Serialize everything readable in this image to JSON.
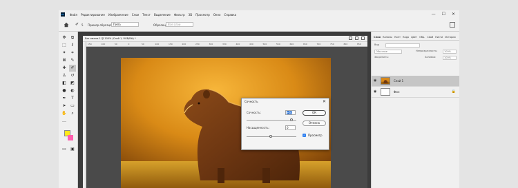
{
  "app": {
    "logo": "Ps",
    "menus": [
      "Файл",
      "Редактирование",
      "Изображение",
      "Слои",
      "Текст",
      "Выделение",
      "Фильтр",
      "3D",
      "Просмотр",
      "Окно",
      "Справка"
    ],
    "window_controls": [
      "—",
      "☐",
      "✕"
    ]
  },
  "options_bar": {
    "brush_size": "5",
    "sample_label": "Пример образца:",
    "sample_value": "Пипа",
    "normal_label": "Образец:",
    "normal_value": "Все слои"
  },
  "toolbar": {
    "tools": [
      {
        "name": "move-tool-icon",
        "glyph": "✥"
      },
      {
        "name": "artboard-tool-icon",
        "glyph": "⧉"
      },
      {
        "name": "marquee-tool-icon",
        "glyph": "⬚"
      },
      {
        "name": "lasso-tool-icon",
        "glyph": "ℓ"
      },
      {
        "name": "magic-wand-tool-icon",
        "glyph": "✦"
      },
      {
        "name": "crop-tool-icon",
        "glyph": "⌗"
      },
      {
        "name": "frame-tool-icon",
        "glyph": "⊠"
      },
      {
        "name": "eyedropper-tool-icon",
        "glyph": "✎"
      },
      {
        "name": "healing-brush-tool-icon",
        "glyph": "✚"
      },
      {
        "name": "brush-tool-icon",
        "glyph": "✐"
      },
      {
        "name": "stamp-tool-icon",
        "glyph": "♙"
      },
      {
        "name": "history-brush-tool-icon",
        "glyph": "↺"
      },
      {
        "name": "eraser-tool-icon",
        "glyph": "◧"
      },
      {
        "name": "gradient-tool-icon",
        "glyph": "◩"
      },
      {
        "name": "blur-tool-icon",
        "glyph": "●"
      },
      {
        "name": "dodge-tool-icon",
        "glyph": "◐"
      },
      {
        "name": "pen-tool-icon",
        "glyph": "✒"
      },
      {
        "name": "text-tool-icon",
        "glyph": "T"
      },
      {
        "name": "path-selection-tool-icon",
        "glyph": "➤"
      },
      {
        "name": "rectangle-tool-icon",
        "glyph": "▭"
      },
      {
        "name": "hand-tool-icon",
        "glyph": "✋"
      },
      {
        "name": "zoom-tool-icon",
        "glyph": "⌕"
      },
      {
        "name": "more-tools-icon",
        "glyph": "…"
      }
    ],
    "fg_color": "#ffe81a",
    "bg_color": "#ff5fae",
    "bottom_icons": [
      "▭",
      "▣"
    ]
  },
  "document": {
    "tab_title": "Без имени-1 @ 100% (Слой 1, RGB/8#) *",
    "ruler_ticks": [
      "150",
      "100",
      "50",
      "0",
      "50",
      "100",
      "150",
      "200",
      "250",
      "300",
      "350",
      "400",
      "450",
      "500",
      "550",
      "600",
      "650",
      "700",
      "750",
      "800",
      "850"
    ]
  },
  "dialog": {
    "title": "Сочность",
    "close": "✕",
    "vibrance_label": "Сочность:",
    "vibrance_value": "+61",
    "saturation_label": "Насыщенность:",
    "saturation_value": "0",
    "ok_label": "ОК",
    "cancel_label": "Отмена",
    "preview_label": "Просмотр",
    "preview_checked": true
  },
  "panel": {
    "tabs": [
      "Слои",
      "Каналы",
      "Конт",
      "Корр",
      "Цвет",
      "Обр.",
      "Свой",
      "Кисти",
      "История"
    ],
    "search_label": "Вид",
    "mode_label": "Обычные",
    "opacity_label": "Непрозрачность:",
    "opacity_value": "100%",
    "lock_label": "Закрепить:",
    "fill_label": "Заливка:",
    "fill_value": "100%",
    "layers": [
      {
        "name": "Слой 1",
        "selected": true,
        "locked": false
      },
      {
        "name": "Фон",
        "selected": false,
        "locked": true
      }
    ]
  }
}
